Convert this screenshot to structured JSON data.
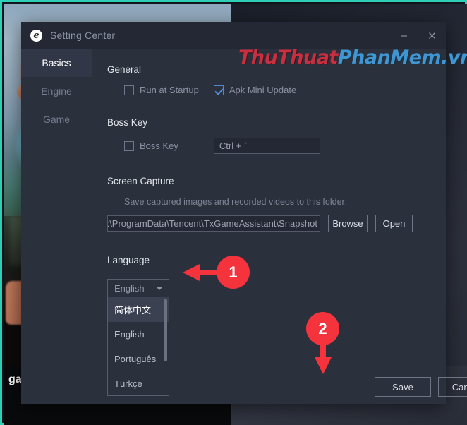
{
  "desktop": {
    "game_caption": "gam"
  },
  "watermark": {
    "part1": "ThuThuat",
    "part2": "PhanMem.vn",
    "color1": "#c8303f",
    "color2": "#3f96d2"
  },
  "window": {
    "title": "Setting Center",
    "icon": "app-logo-icon",
    "minimize_label": "minimize-icon",
    "close_label": "close-icon"
  },
  "sidebar": {
    "items": [
      {
        "label": "Basics",
        "active": true
      },
      {
        "label": "Engine",
        "active": false
      },
      {
        "label": "Game",
        "active": false
      }
    ]
  },
  "general": {
    "heading": "General",
    "run_at_startup": {
      "label": "Run at Startup",
      "checked": false
    },
    "apk_mini_update": {
      "label": "Apk Mini Update",
      "checked": true
    }
  },
  "boss_key": {
    "heading": "Boss Key",
    "checkbox_label": "Boss Key",
    "checked": false,
    "shortcut_value": "Ctrl + `"
  },
  "screen_capture": {
    "heading": "Screen Capture",
    "hint": "Save captured images and recorded videos to this folder:",
    "path_value": "C:\\ProgramData\\Tencent\\TxGameAssistant\\Snapshot",
    "browse_label": "Browse",
    "open_label": "Open"
  },
  "language": {
    "heading": "Language",
    "selected": "English",
    "options": [
      {
        "label": "简体中文",
        "selected": true
      },
      {
        "label": "English",
        "selected": false
      },
      {
        "label": "Português",
        "selected": false
      },
      {
        "label": "Türkçe",
        "selected": false
      }
    ]
  },
  "footer": {
    "save_label": "Save",
    "cancel_label": "Cancel"
  },
  "annotations": {
    "color": "#f4333d",
    "step1": "1",
    "step2": "2"
  }
}
